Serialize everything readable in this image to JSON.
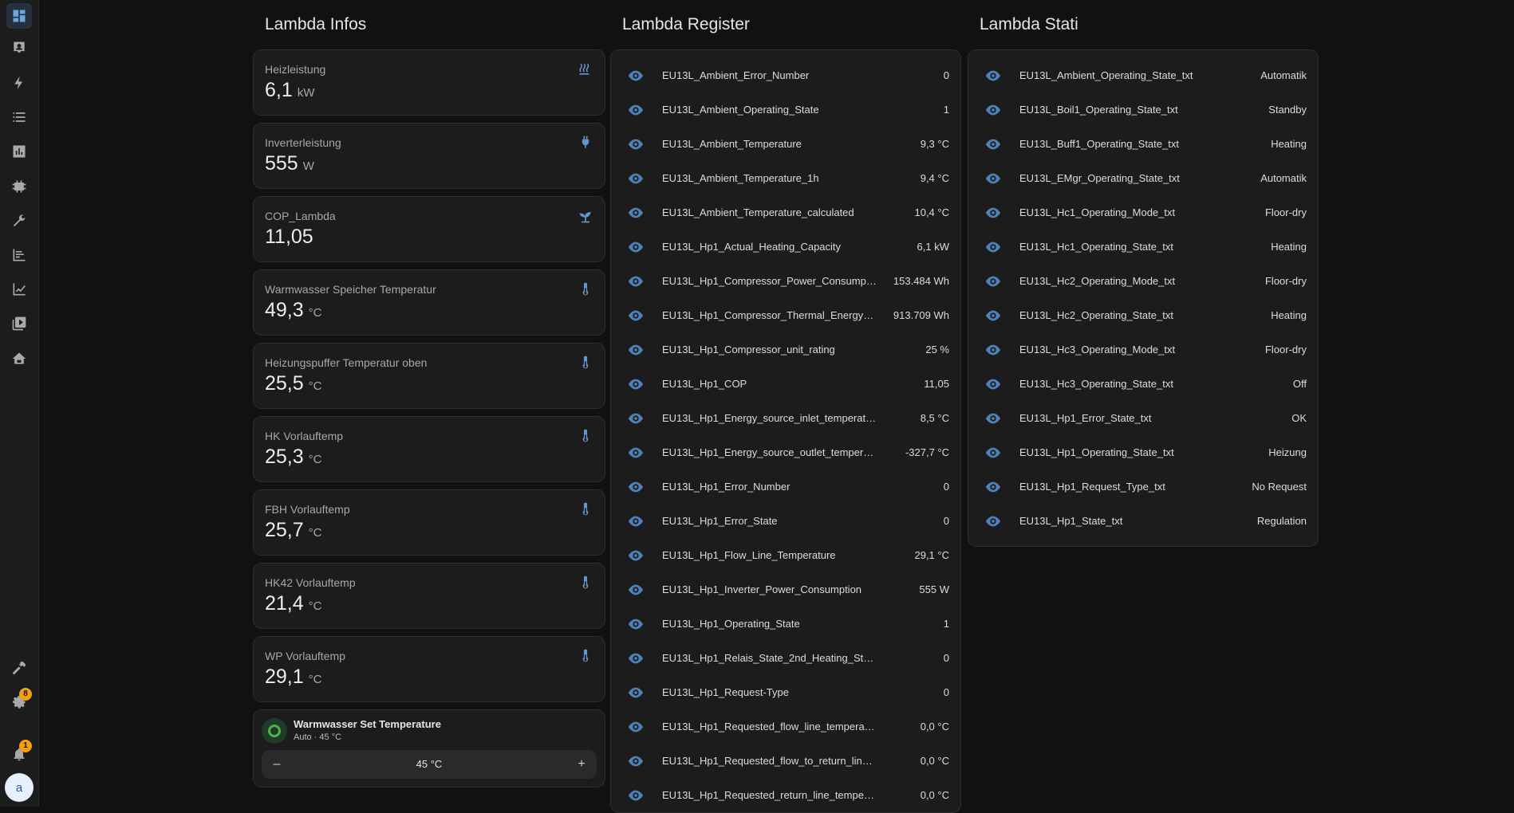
{
  "sidebar": {
    "items": [
      {
        "icon": "dashboard-icon"
      },
      {
        "icon": "map-icon"
      },
      {
        "icon": "energy-icon"
      },
      {
        "icon": "logbook-icon"
      },
      {
        "icon": "history-icon"
      },
      {
        "icon": "integration-icon"
      },
      {
        "icon": "wrench-icon"
      },
      {
        "icon": "chart-icon"
      },
      {
        "icon": "statistics-icon"
      },
      {
        "icon": "media-icon"
      },
      {
        "icon": "home-icon"
      }
    ],
    "developer_tools_icon": "hammer-icon",
    "settings_icon": "gear-icon",
    "settings_badge": "8",
    "notifications_icon": "bell-icon",
    "notifications_badge": "1",
    "avatar_letter": "a"
  },
  "columns": {
    "infos_title": "Lambda Infos",
    "register_title": "Lambda Register",
    "stati_title": "Lambda Stati"
  },
  "tiles": [
    {
      "name": "Heizleistung",
      "value": "6,1",
      "unit": "kW",
      "icon": "radiator-icon"
    },
    {
      "name": "Inverterleistung",
      "value": "555",
      "unit": "W",
      "icon": "plug-icon"
    },
    {
      "name": "COP_Lambda",
      "value": "11,05",
      "unit": "",
      "icon": "sprout-icon"
    },
    {
      "name": "Warmwasser Speicher Temperatur",
      "value": "49,3",
      "unit": "°C",
      "icon": "thermometer-icon"
    },
    {
      "name": "Heizungspuffer Temperatur oben",
      "value": "25,5",
      "unit": "°C",
      "icon": "thermometer-icon"
    },
    {
      "name": "HK Vorlauftemp",
      "value": "25,3",
      "unit": "°C",
      "icon": "thermometer-icon"
    },
    {
      "name": "FBH Vorlauftemp",
      "value": "25,7",
      "unit": "°C",
      "icon": "thermometer-icon"
    },
    {
      "name": "HK42 Vorlauftemp",
      "value": "21,4",
      "unit": "°C",
      "icon": "thermometer-icon"
    },
    {
      "name": "WP Vorlauftemp",
      "value": "29,1",
      "unit": "°C",
      "icon": "thermometer-icon"
    }
  ],
  "water_heater": {
    "title": "Warmwasser Set Temperature",
    "subtitle": "Auto · 45 °C",
    "minus": "–",
    "value": "45 °C",
    "plus": "+"
  },
  "register": [
    {
      "name": "EU13L_Ambient_Error_Number",
      "value": "0"
    },
    {
      "name": "EU13L_Ambient_Operating_State",
      "value": "1"
    },
    {
      "name": "EU13L_Ambient_Temperature",
      "value": "9,3 °C"
    },
    {
      "name": "EU13L_Ambient_Temperature_1h",
      "value": "9,4 °C"
    },
    {
      "name": "EU13L_Ambient_Temperature_calculated",
      "value": "10,4 °C"
    },
    {
      "name": "EU13L_Hp1_Actual_Heating_Capacity",
      "value": "6,1 kW"
    },
    {
      "name": "EU13L_Hp1_Compressor_Power_Consumption_a...",
      "value": "153.484 Wh"
    },
    {
      "name": "EU13L_Hp1_Compressor_Thermal_Energy_Output...",
      "value": "913.709 Wh"
    },
    {
      "name": "EU13L_Hp1_Compressor_unit_rating",
      "value": "25 %"
    },
    {
      "name": "EU13L_Hp1_COP",
      "value": "11,05"
    },
    {
      "name": "EU13L_Hp1_Energy_source_inlet_temperature",
      "value": "8,5 °C"
    },
    {
      "name": "EU13L_Hp1_Energy_source_outlet_temperature",
      "value": "-327,7 °C"
    },
    {
      "name": "EU13L_Hp1_Error_Number",
      "value": "0"
    },
    {
      "name": "EU13L_Hp1_Error_State",
      "value": "0"
    },
    {
      "name": "EU13L_Hp1_Flow_Line_Temperature",
      "value": "29,1 °C"
    },
    {
      "name": "EU13L_Hp1_Inverter_Power_Consumption",
      "value": "555 W"
    },
    {
      "name": "EU13L_Hp1_Operating_State",
      "value": "1"
    },
    {
      "name": "EU13L_Hp1_Relais_State_2nd_Heating_Stage",
      "value": "0"
    },
    {
      "name": "EU13L_Hp1_Request-Type",
      "value": "0"
    },
    {
      "name": "EU13L_Hp1_Requested_flow_line_temperature",
      "value": "0,0 °C"
    },
    {
      "name": "EU13L_Hp1_Requested_flow_to_return_line_temperatur...",
      "value": "0,0 °C"
    },
    {
      "name": "EU13L_Hp1_Requested_return_line_temperature",
      "value": "0,0 °C"
    }
  ],
  "stati": [
    {
      "name": "EU13L_Ambient_Operating_State_txt",
      "value": "Automatik"
    },
    {
      "name": "EU13L_Boil1_Operating_State_txt",
      "value": "Standby"
    },
    {
      "name": "EU13L_Buff1_Operating_State_txt",
      "value": "Heating"
    },
    {
      "name": "EU13L_EMgr_Operating_State_txt",
      "value": "Automatik"
    },
    {
      "name": "EU13L_Hc1_Operating_Mode_txt",
      "value": "Floor-dry"
    },
    {
      "name": "EU13L_Hc1_Operating_State_txt",
      "value": "Heating"
    },
    {
      "name": "EU13L_Hc2_Operating_Mode_txt",
      "value": "Floor-dry"
    },
    {
      "name": "EU13L_Hc2_Operating_State_txt",
      "value": "Heating"
    },
    {
      "name": "EU13L_Hc3_Operating_Mode_txt",
      "value": "Floor-dry"
    },
    {
      "name": "EU13L_Hc3_Operating_State_txt",
      "value": "Off"
    },
    {
      "name": "EU13L_Hp1_Error_State_txt",
      "value": "OK"
    },
    {
      "name": "EU13L_Hp1_Operating_State_txt",
      "value": "Heizung"
    },
    {
      "name": "EU13L_Hp1_Request_Type_txt",
      "value": "No Request"
    },
    {
      "name": "EU13L_Hp1_State_txt",
      "value": "Regulation"
    }
  ],
  "colors": {
    "accent": "#6396cf",
    "eye": "#4f80b7",
    "badge": "#f3a00c",
    "background": "#111111",
    "card": "#1c1c1c"
  }
}
